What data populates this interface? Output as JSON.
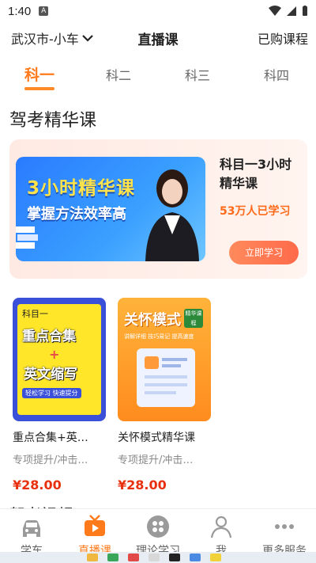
{
  "status": {
    "time": "1:40",
    "app_icon": "A"
  },
  "header": {
    "city": "武汉市-小车",
    "title": "直播课",
    "purchased": "已购课程"
  },
  "tabs": [
    {
      "label": "科一",
      "active": true
    },
    {
      "label": "科二",
      "active": false
    },
    {
      "label": "科三",
      "active": false
    },
    {
      "label": "科四",
      "active": false
    }
  ],
  "section_title": "驾考精华课",
  "hero": {
    "banner_title": "3小时精华课",
    "banner_subtitle": "掌握方法效率高",
    "title": "科目一3小时精华课",
    "count": "53万人已学习",
    "button": "立即学习"
  },
  "courses": [
    {
      "thumb_subject": "科目一",
      "thumb_line1": "重点合集",
      "thumb_plus": "+",
      "thumb_line2": "英文缩写",
      "thumb_tag": "轻松学习 快速提分",
      "name": "重点合集+英…",
      "tags": "专项提升/冲击…",
      "price": "¥28.00"
    },
    {
      "thumb_title": "关怀模式",
      "thumb_badge": "精华课程",
      "thumb_tagline": "讲解详细 技巧易记 提高速度",
      "name": "关怀模式精华课",
      "tags": "专项提升/冲击…",
      "price": "¥28.00"
    }
  ],
  "next_section": "驾考视频",
  "nav": [
    {
      "label": "学车",
      "icon": "car-icon",
      "active": false
    },
    {
      "label": "直播课",
      "icon": "tv-icon",
      "active": true
    },
    {
      "label": "理论学习",
      "icon": "grid-icon",
      "active": false
    },
    {
      "label": "我",
      "icon": "person-icon",
      "active": false
    },
    {
      "label": "更多服务",
      "icon": "more-icon",
      "active": false
    }
  ],
  "colors": {
    "accent": "#ff7a1a",
    "price": "#e8300e",
    "banner_blue": "#2a7bff"
  }
}
